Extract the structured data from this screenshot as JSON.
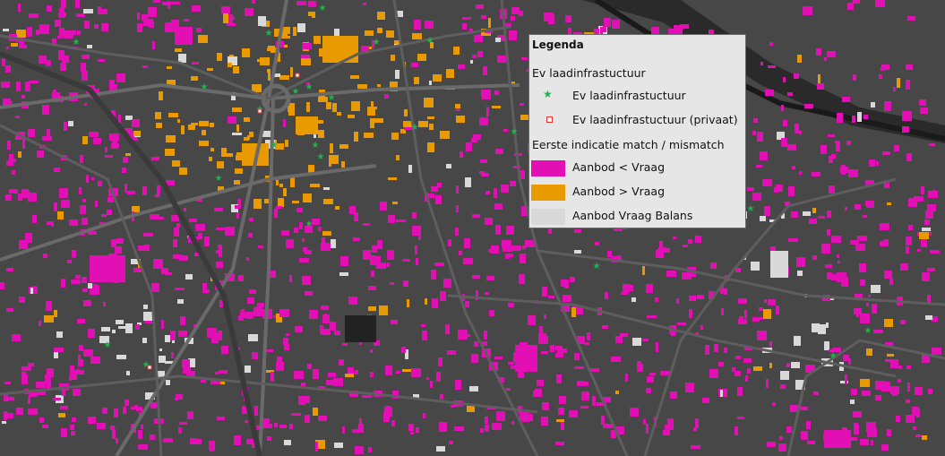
{
  "map": {
    "background": "#474747",
    "colors": {
      "demand_greater": "#e20fb4",
      "supply_greater": "#e89a00",
      "balance": "#d9d9d9",
      "road": "#5e5e5e",
      "major_road": "#6a6a6a",
      "railway": "#3a3a3a",
      "charger_public": "#22b14c",
      "charger_private": "#e53030"
    }
  },
  "legend": {
    "title": "Legenda",
    "group1_title": "Ev laadinfrastuctuur",
    "public_label": "Ev laadinfrastuctuur",
    "private_label": "Ev laadinfrastuctuur (privaat)",
    "group2_title": "Eerste indicatie match / mismatch",
    "demand_greater_label": "Aanbod < Vraag",
    "supply_greater_label": "Aanbod > Vraag",
    "balance_label": "Aanbod Vraag Balans",
    "public_symbol": "star-icon",
    "private_symbol": "square-icon"
  }
}
